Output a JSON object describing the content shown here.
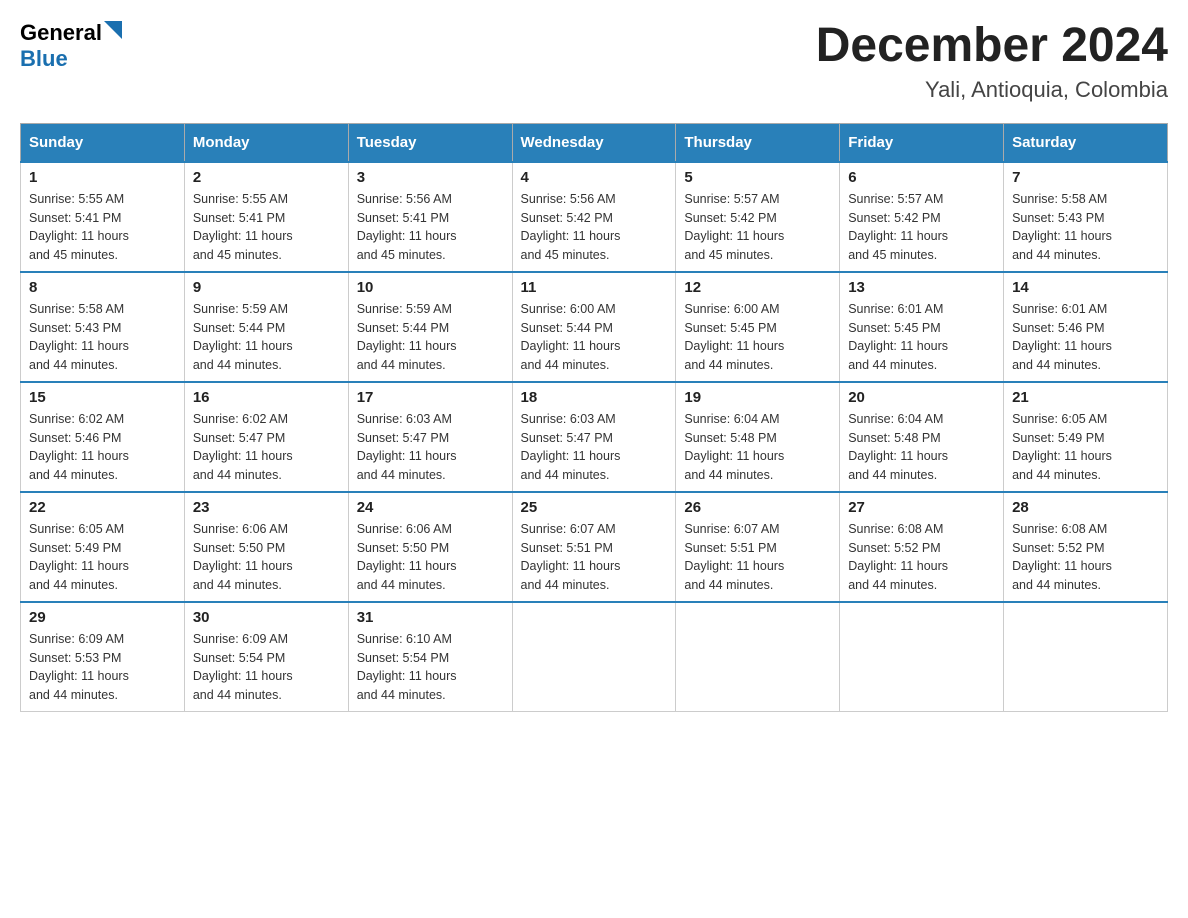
{
  "logo": {
    "general": "General",
    "blue": "Blue"
  },
  "title": {
    "month_year": "December 2024",
    "location": "Yali, Antioquia, Colombia"
  },
  "header_days": [
    "Sunday",
    "Monday",
    "Tuesday",
    "Wednesday",
    "Thursday",
    "Friday",
    "Saturday"
  ],
  "weeks": [
    [
      {
        "day": "1",
        "sunrise": "5:55 AM",
        "sunset": "5:41 PM",
        "daylight": "11 hours and 45 minutes."
      },
      {
        "day": "2",
        "sunrise": "5:55 AM",
        "sunset": "5:41 PM",
        "daylight": "11 hours and 45 minutes."
      },
      {
        "day": "3",
        "sunrise": "5:56 AM",
        "sunset": "5:41 PM",
        "daylight": "11 hours and 45 minutes."
      },
      {
        "day": "4",
        "sunrise": "5:56 AM",
        "sunset": "5:42 PM",
        "daylight": "11 hours and 45 minutes."
      },
      {
        "day": "5",
        "sunrise": "5:57 AM",
        "sunset": "5:42 PM",
        "daylight": "11 hours and 45 minutes."
      },
      {
        "day": "6",
        "sunrise": "5:57 AM",
        "sunset": "5:42 PM",
        "daylight": "11 hours and 45 minutes."
      },
      {
        "day": "7",
        "sunrise": "5:58 AM",
        "sunset": "5:43 PM",
        "daylight": "11 hours and 44 minutes."
      }
    ],
    [
      {
        "day": "8",
        "sunrise": "5:58 AM",
        "sunset": "5:43 PM",
        "daylight": "11 hours and 44 minutes."
      },
      {
        "day": "9",
        "sunrise": "5:59 AM",
        "sunset": "5:44 PM",
        "daylight": "11 hours and 44 minutes."
      },
      {
        "day": "10",
        "sunrise": "5:59 AM",
        "sunset": "5:44 PM",
        "daylight": "11 hours and 44 minutes."
      },
      {
        "day": "11",
        "sunrise": "6:00 AM",
        "sunset": "5:44 PM",
        "daylight": "11 hours and 44 minutes."
      },
      {
        "day": "12",
        "sunrise": "6:00 AM",
        "sunset": "5:45 PM",
        "daylight": "11 hours and 44 minutes."
      },
      {
        "day": "13",
        "sunrise": "6:01 AM",
        "sunset": "5:45 PM",
        "daylight": "11 hours and 44 minutes."
      },
      {
        "day": "14",
        "sunrise": "6:01 AM",
        "sunset": "5:46 PM",
        "daylight": "11 hours and 44 minutes."
      }
    ],
    [
      {
        "day": "15",
        "sunrise": "6:02 AM",
        "sunset": "5:46 PM",
        "daylight": "11 hours and 44 minutes."
      },
      {
        "day": "16",
        "sunrise": "6:02 AM",
        "sunset": "5:47 PM",
        "daylight": "11 hours and 44 minutes."
      },
      {
        "day": "17",
        "sunrise": "6:03 AM",
        "sunset": "5:47 PM",
        "daylight": "11 hours and 44 minutes."
      },
      {
        "day": "18",
        "sunrise": "6:03 AM",
        "sunset": "5:47 PM",
        "daylight": "11 hours and 44 minutes."
      },
      {
        "day": "19",
        "sunrise": "6:04 AM",
        "sunset": "5:48 PM",
        "daylight": "11 hours and 44 minutes."
      },
      {
        "day": "20",
        "sunrise": "6:04 AM",
        "sunset": "5:48 PM",
        "daylight": "11 hours and 44 minutes."
      },
      {
        "day": "21",
        "sunrise": "6:05 AM",
        "sunset": "5:49 PM",
        "daylight": "11 hours and 44 minutes."
      }
    ],
    [
      {
        "day": "22",
        "sunrise": "6:05 AM",
        "sunset": "5:49 PM",
        "daylight": "11 hours and 44 minutes."
      },
      {
        "day": "23",
        "sunrise": "6:06 AM",
        "sunset": "5:50 PM",
        "daylight": "11 hours and 44 minutes."
      },
      {
        "day": "24",
        "sunrise": "6:06 AM",
        "sunset": "5:50 PM",
        "daylight": "11 hours and 44 minutes."
      },
      {
        "day": "25",
        "sunrise": "6:07 AM",
        "sunset": "5:51 PM",
        "daylight": "11 hours and 44 minutes."
      },
      {
        "day": "26",
        "sunrise": "6:07 AM",
        "sunset": "5:51 PM",
        "daylight": "11 hours and 44 minutes."
      },
      {
        "day": "27",
        "sunrise": "6:08 AM",
        "sunset": "5:52 PM",
        "daylight": "11 hours and 44 minutes."
      },
      {
        "day": "28",
        "sunrise": "6:08 AM",
        "sunset": "5:52 PM",
        "daylight": "11 hours and 44 minutes."
      }
    ],
    [
      {
        "day": "29",
        "sunrise": "6:09 AM",
        "sunset": "5:53 PM",
        "daylight": "11 hours and 44 minutes."
      },
      {
        "day": "30",
        "sunrise": "6:09 AM",
        "sunset": "5:54 PM",
        "daylight": "11 hours and 44 minutes."
      },
      {
        "day": "31",
        "sunrise": "6:10 AM",
        "sunset": "5:54 PM",
        "daylight": "11 hours and 44 minutes."
      },
      null,
      null,
      null,
      null
    ]
  ],
  "labels": {
    "sunrise": "Sunrise:",
    "sunset": "Sunset:",
    "daylight": "Daylight:"
  }
}
